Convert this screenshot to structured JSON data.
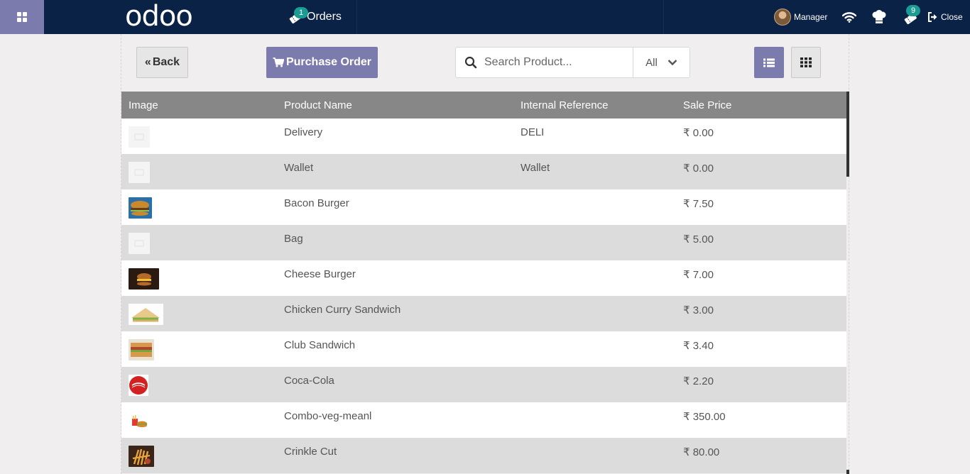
{
  "app": {
    "logo_text": "odoo",
    "nav_orders_label": "Orders",
    "orders_badge": "1",
    "user_name": "Manager",
    "kitchen_badge": "9",
    "close_label": "Close"
  },
  "toolbar": {
    "back_label": "Back",
    "purchase_order_label": "Purchase Order",
    "search_placeholder": "Search Product...",
    "filter_value": "All"
  },
  "table": {
    "headers": [
      "Image",
      "Product Name",
      "Internal Reference",
      "Sale Price"
    ],
    "rows": [
      {
        "image": "placeholder",
        "name": "Delivery",
        "ref": "DELI",
        "price": "₹ 0.00"
      },
      {
        "image": "placeholder",
        "name": "Wallet",
        "ref": "Wallet",
        "price": "₹ 0.00"
      },
      {
        "image": "bacon-burger",
        "name": "Bacon Burger",
        "ref": "",
        "price": "₹ 7.50"
      },
      {
        "image": "placeholder",
        "name": "Bag",
        "ref": "",
        "price": "₹ 5.00"
      },
      {
        "image": "cheese-burger",
        "name": "Cheese Burger",
        "ref": "",
        "price": "₹ 7.00"
      },
      {
        "image": "sandwich",
        "name": "Chicken Curry Sandwich",
        "ref": "",
        "price": "₹ 3.00"
      },
      {
        "image": "club-sandwich",
        "name": "Club Sandwich",
        "ref": "",
        "price": "₹ 3.40"
      },
      {
        "image": "coca-cola",
        "name": "Coca-Cola",
        "ref": "",
        "price": "₹ 2.20"
      },
      {
        "image": "combo-meal",
        "name": "Combo-veg-meanl",
        "ref": "",
        "price": "₹ 350.00"
      },
      {
        "image": "fries",
        "name": "Crinkle Cut",
        "ref": "",
        "price": "₹ 80.00"
      }
    ]
  },
  "colors": {
    "navbar": "#0a2245",
    "accent": "#7c7bad",
    "badge": "#1a9b93",
    "table_header": "#878787"
  }
}
